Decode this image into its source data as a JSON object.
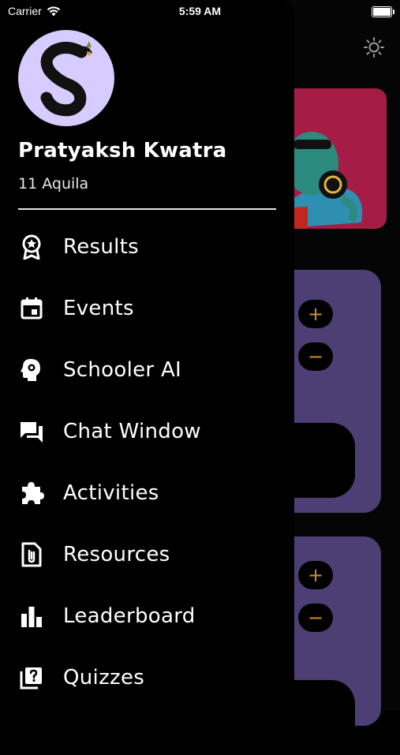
{
  "status_bar": {
    "carrier": "Carrier",
    "time": "5:59 AM",
    "battery_level": 1.0
  },
  "background": {
    "accent_colors": {
      "hero_card": "#a51d46",
      "purple_card": "#4d3e74",
      "button_glyph": "#c8902c"
    },
    "stepper_top": {
      "plus": "+",
      "minus": "−"
    },
    "stepper_bottom": {
      "plus": "+",
      "minus": "−"
    },
    "theme_icon": "sun-icon"
  },
  "drawer": {
    "avatar_icon": "school-logo-s",
    "user": {
      "name": "Pratyaksh Kwatra",
      "class": "11 Aquila"
    },
    "menu": [
      {
        "label": "Results",
        "icon": "award-ribbon-icon"
      },
      {
        "label": "Events",
        "icon": "calendar-icon"
      },
      {
        "label": "Schooler AI",
        "icon": "brain-head-icon"
      },
      {
        "label": "Chat Window",
        "icon": "chat-bubbles-icon"
      },
      {
        "label": "Activities",
        "icon": "puzzle-icon"
      },
      {
        "label": "Resources",
        "icon": "file-attachment-icon"
      },
      {
        "label": "Leaderboard",
        "icon": "bar-chart-icon"
      },
      {
        "label": "Quizzes",
        "icon": "quiz-icon"
      }
    ]
  }
}
